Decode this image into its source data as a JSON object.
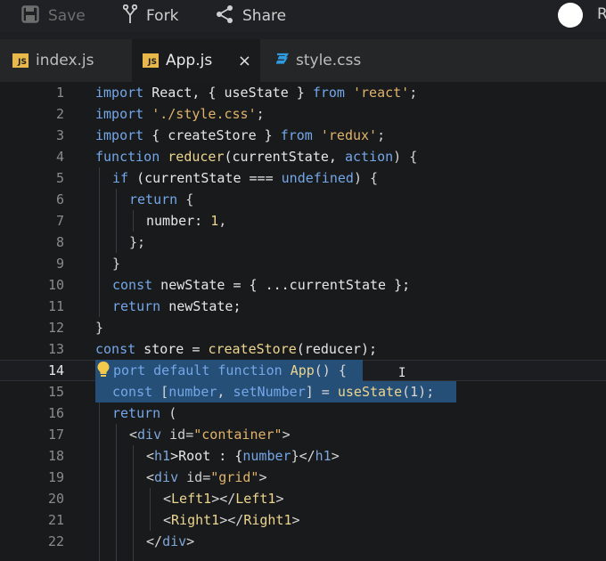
{
  "toolbar": {
    "save_label": "Save",
    "fork_label": "Fork",
    "share_label": "Share",
    "user_initial": "R"
  },
  "tabs": [
    {
      "label": "index.js",
      "type": "js",
      "active": false
    },
    {
      "label": "App.js",
      "type": "js",
      "active": true
    },
    {
      "label": "style.css",
      "type": "css",
      "active": false
    }
  ],
  "tab_close": "×",
  "js_badge": "JS",
  "editor": {
    "current_line": 14,
    "lines": [
      {
        "n": "1"
      },
      {
        "n": "2"
      },
      {
        "n": "3"
      },
      {
        "n": "4"
      },
      {
        "n": "5"
      },
      {
        "n": "6"
      },
      {
        "n": "7"
      },
      {
        "n": "8"
      },
      {
        "n": "9"
      },
      {
        "n": "10"
      },
      {
        "n": "11"
      },
      {
        "n": "12"
      },
      {
        "n": "13"
      },
      {
        "n": "14"
      },
      {
        "n": "15"
      },
      {
        "n": "16"
      },
      {
        "n": "17"
      },
      {
        "n": "18"
      },
      {
        "n": "19"
      },
      {
        "n": "20"
      },
      {
        "n": "21"
      },
      {
        "n": "22"
      }
    ],
    "tokens": {
      "l1": [
        "import",
        " React, { useState } ",
        "from",
        " ",
        "'react'",
        ";"
      ],
      "l2": [
        "import",
        " ",
        "'./style.css'",
        ";"
      ],
      "l3": [
        "import",
        " { createStore } ",
        "from",
        " ",
        "'redux'",
        ";"
      ],
      "l4": [
        "function",
        " ",
        "reducer",
        "(currentState, ",
        "action",
        ") {"
      ],
      "l5": [
        "if",
        " (currentState === ",
        "undefined",
        ") {"
      ],
      "l6": [
        "return",
        " {"
      ],
      "l7": [
        "number: ",
        "1",
        ","
      ],
      "l8": [
        "};"
      ],
      "l9": [
        "}"
      ],
      "l10": [
        "const",
        " newState = { ...currentState };"
      ],
      "l11": [
        "return",
        " newState;"
      ],
      "l12": [
        "}"
      ],
      "l13": [
        "const",
        " store = ",
        "createStore",
        "(reducer);"
      ],
      "l14": [
        "port",
        " ",
        "default",
        " ",
        "function",
        " ",
        "App",
        "() ",
        "{"
      ],
      "l15": [
        "const",
        " [",
        "number",
        ", ",
        "setNumber",
        "] = ",
        "useState",
        "(1);"
      ],
      "l16": [
        "return",
        " ("
      ],
      "l17": [
        "<",
        "div",
        " id=",
        "\"container\"",
        ">"
      ],
      "l18": [
        "<",
        "h1",
        ">Root : {",
        "number",
        "}</",
        "h1",
        ">"
      ],
      "l19": [
        "<",
        "div",
        " id=",
        "\"grid\"",
        ">"
      ],
      "l20": [
        "<",
        "Left1",
        "></",
        "Left1",
        ">"
      ],
      "l21": [
        "<",
        "Right1",
        "></",
        "Right1",
        ">"
      ],
      "l22": [
        "</",
        "div",
        ">"
      ]
    }
  },
  "colors": {
    "keyword": "#74a7e8",
    "string": "#e0b36a",
    "function": "#ecd58f",
    "selection": "#264f78",
    "background": "#191a1c"
  }
}
